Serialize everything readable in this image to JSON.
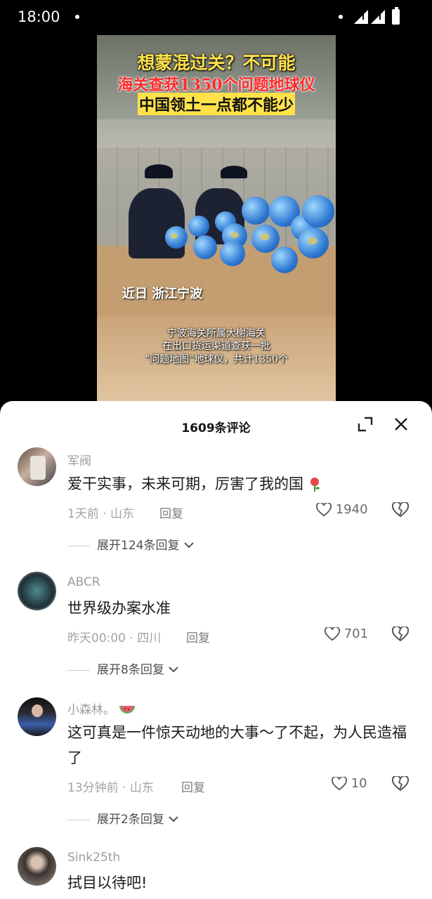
{
  "status_bar": {
    "time": "18:00"
  },
  "video": {
    "title_line1": "想蒙混过关？不可能",
    "title_line2": "海关查获1350个问题地球仪",
    "title_line3": "中国领土一点都不能少",
    "location_caption": "近日 浙江宁波",
    "subtitle_line1": "宁波海关所属大榭海关",
    "subtitle_line2": "在出口货运渠道查获一批",
    "subtitle_line3": "“问题地图”地球仪，共计1350个"
  },
  "sheet": {
    "title": "1609条评论"
  },
  "comments": [
    {
      "username": "军阀",
      "text": "爱干实事，未来可期，厉害了我的国",
      "meta": "1天前 · 山东",
      "reply_label": "回复",
      "likes": "1940",
      "expand_label": "展开124条回复"
    },
    {
      "username": "ABCR",
      "text": "世界级办案水准",
      "meta": "昨天00:00 · 四川",
      "reply_label": "回复",
      "likes": "701",
      "expand_label": "展开8条回复"
    },
    {
      "username": "小森林。",
      "text": "这可真是一件惊天动地的大事～了不起，为人民造福了",
      "meta": "13分钟前 · 山东",
      "reply_label": "回复",
      "likes": "10",
      "expand_label": "展开2条回复"
    },
    {
      "username": "Sink25th",
      "text": "拭目以待吧!"
    }
  ]
}
